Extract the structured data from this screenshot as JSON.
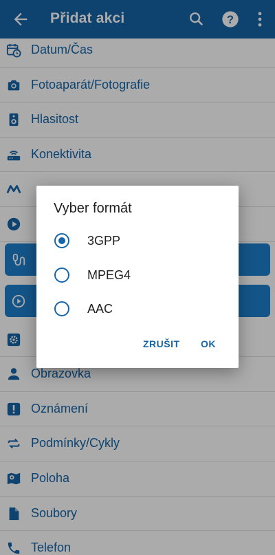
{
  "appbar": {
    "title": "Přidat akci",
    "back_icon": "arrow-back-icon",
    "actions": [
      "search-icon",
      "help-icon",
      "more-vert-icon"
    ]
  },
  "list": {
    "items": [
      {
        "label": "Datum/Čas",
        "icon": "calendar-clock-icon"
      },
      {
        "label": "Fotoaparát/Fotografie",
        "icon": "camera-icon"
      },
      {
        "label": "Hlasitost",
        "icon": "speaker-icon"
      },
      {
        "label": "Konektivita",
        "icon": "router-icon"
      },
      {
        "label": "",
        "icon": "macrodroid-icon"
      },
      {
        "label": "",
        "icon": "play-circle-icon"
      },
      {
        "label": "",
        "icon": "microphone-icon"
      },
      {
        "label": "",
        "icon": "play-circle-outline-icon"
      },
      {
        "label": "",
        "icon": "settings-box-icon"
      },
      {
        "label": "Obrazovka",
        "icon": "person-icon"
      },
      {
        "label": "Oznámení",
        "icon": "alert-box-icon"
      },
      {
        "label": "Podmínky/Cykly",
        "icon": "repeat-icon"
      },
      {
        "label": "Poloha",
        "icon": "map-pin-icon"
      },
      {
        "label": "Soubory",
        "icon": "file-icon"
      },
      {
        "label": "Telefon",
        "icon": "phone-icon"
      }
    ]
  },
  "dialog": {
    "title": "Vyber formát",
    "options": [
      {
        "label": "3GPP",
        "selected": true
      },
      {
        "label": "MPEG4",
        "selected": false
      },
      {
        "label": "AAC",
        "selected": false
      }
    ],
    "cancel_label": "ZRUŠIT",
    "ok_label": "OK"
  },
  "colors": {
    "primary": "#1565a8",
    "card": "#1f7fcc"
  }
}
